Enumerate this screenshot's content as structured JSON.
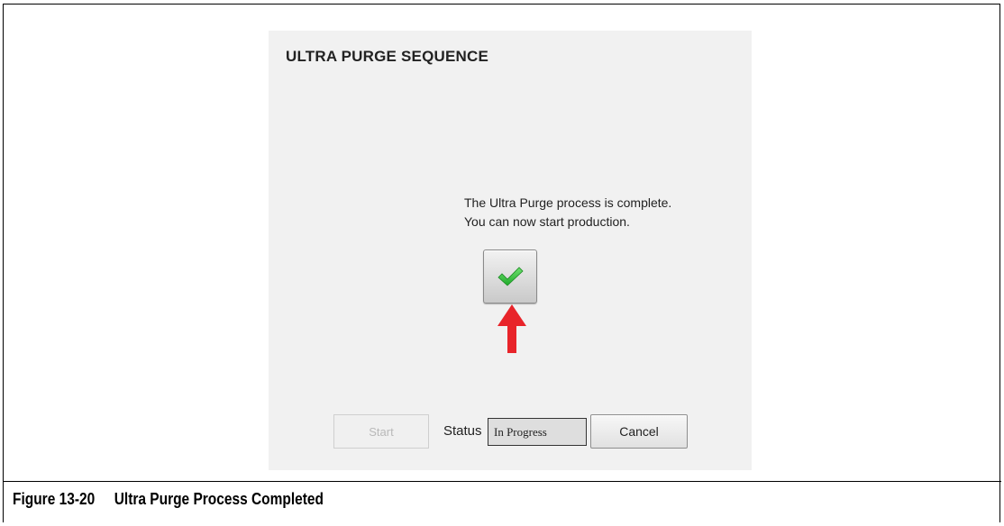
{
  "dialog": {
    "title": "ULTRA PURGE SEQUENCE",
    "message_line1": "The Ultra Purge process is complete.",
    "message_line2": "You can now start production.",
    "confirm_icon": "checkmark-icon",
    "pointer_icon": "red-arrow-up-icon",
    "start_label": "Start",
    "status_label": "Status",
    "status_value": "In Progress",
    "cancel_label": "Cancel"
  },
  "figure": {
    "number": "Figure 13-20",
    "title": "Ultra Purge Process Completed"
  },
  "colors": {
    "dialog_background": "#f1f1f1",
    "checkmark": "#3fc63f",
    "arrow": "#e8242a",
    "disabled_text": "#b9b9b9"
  }
}
